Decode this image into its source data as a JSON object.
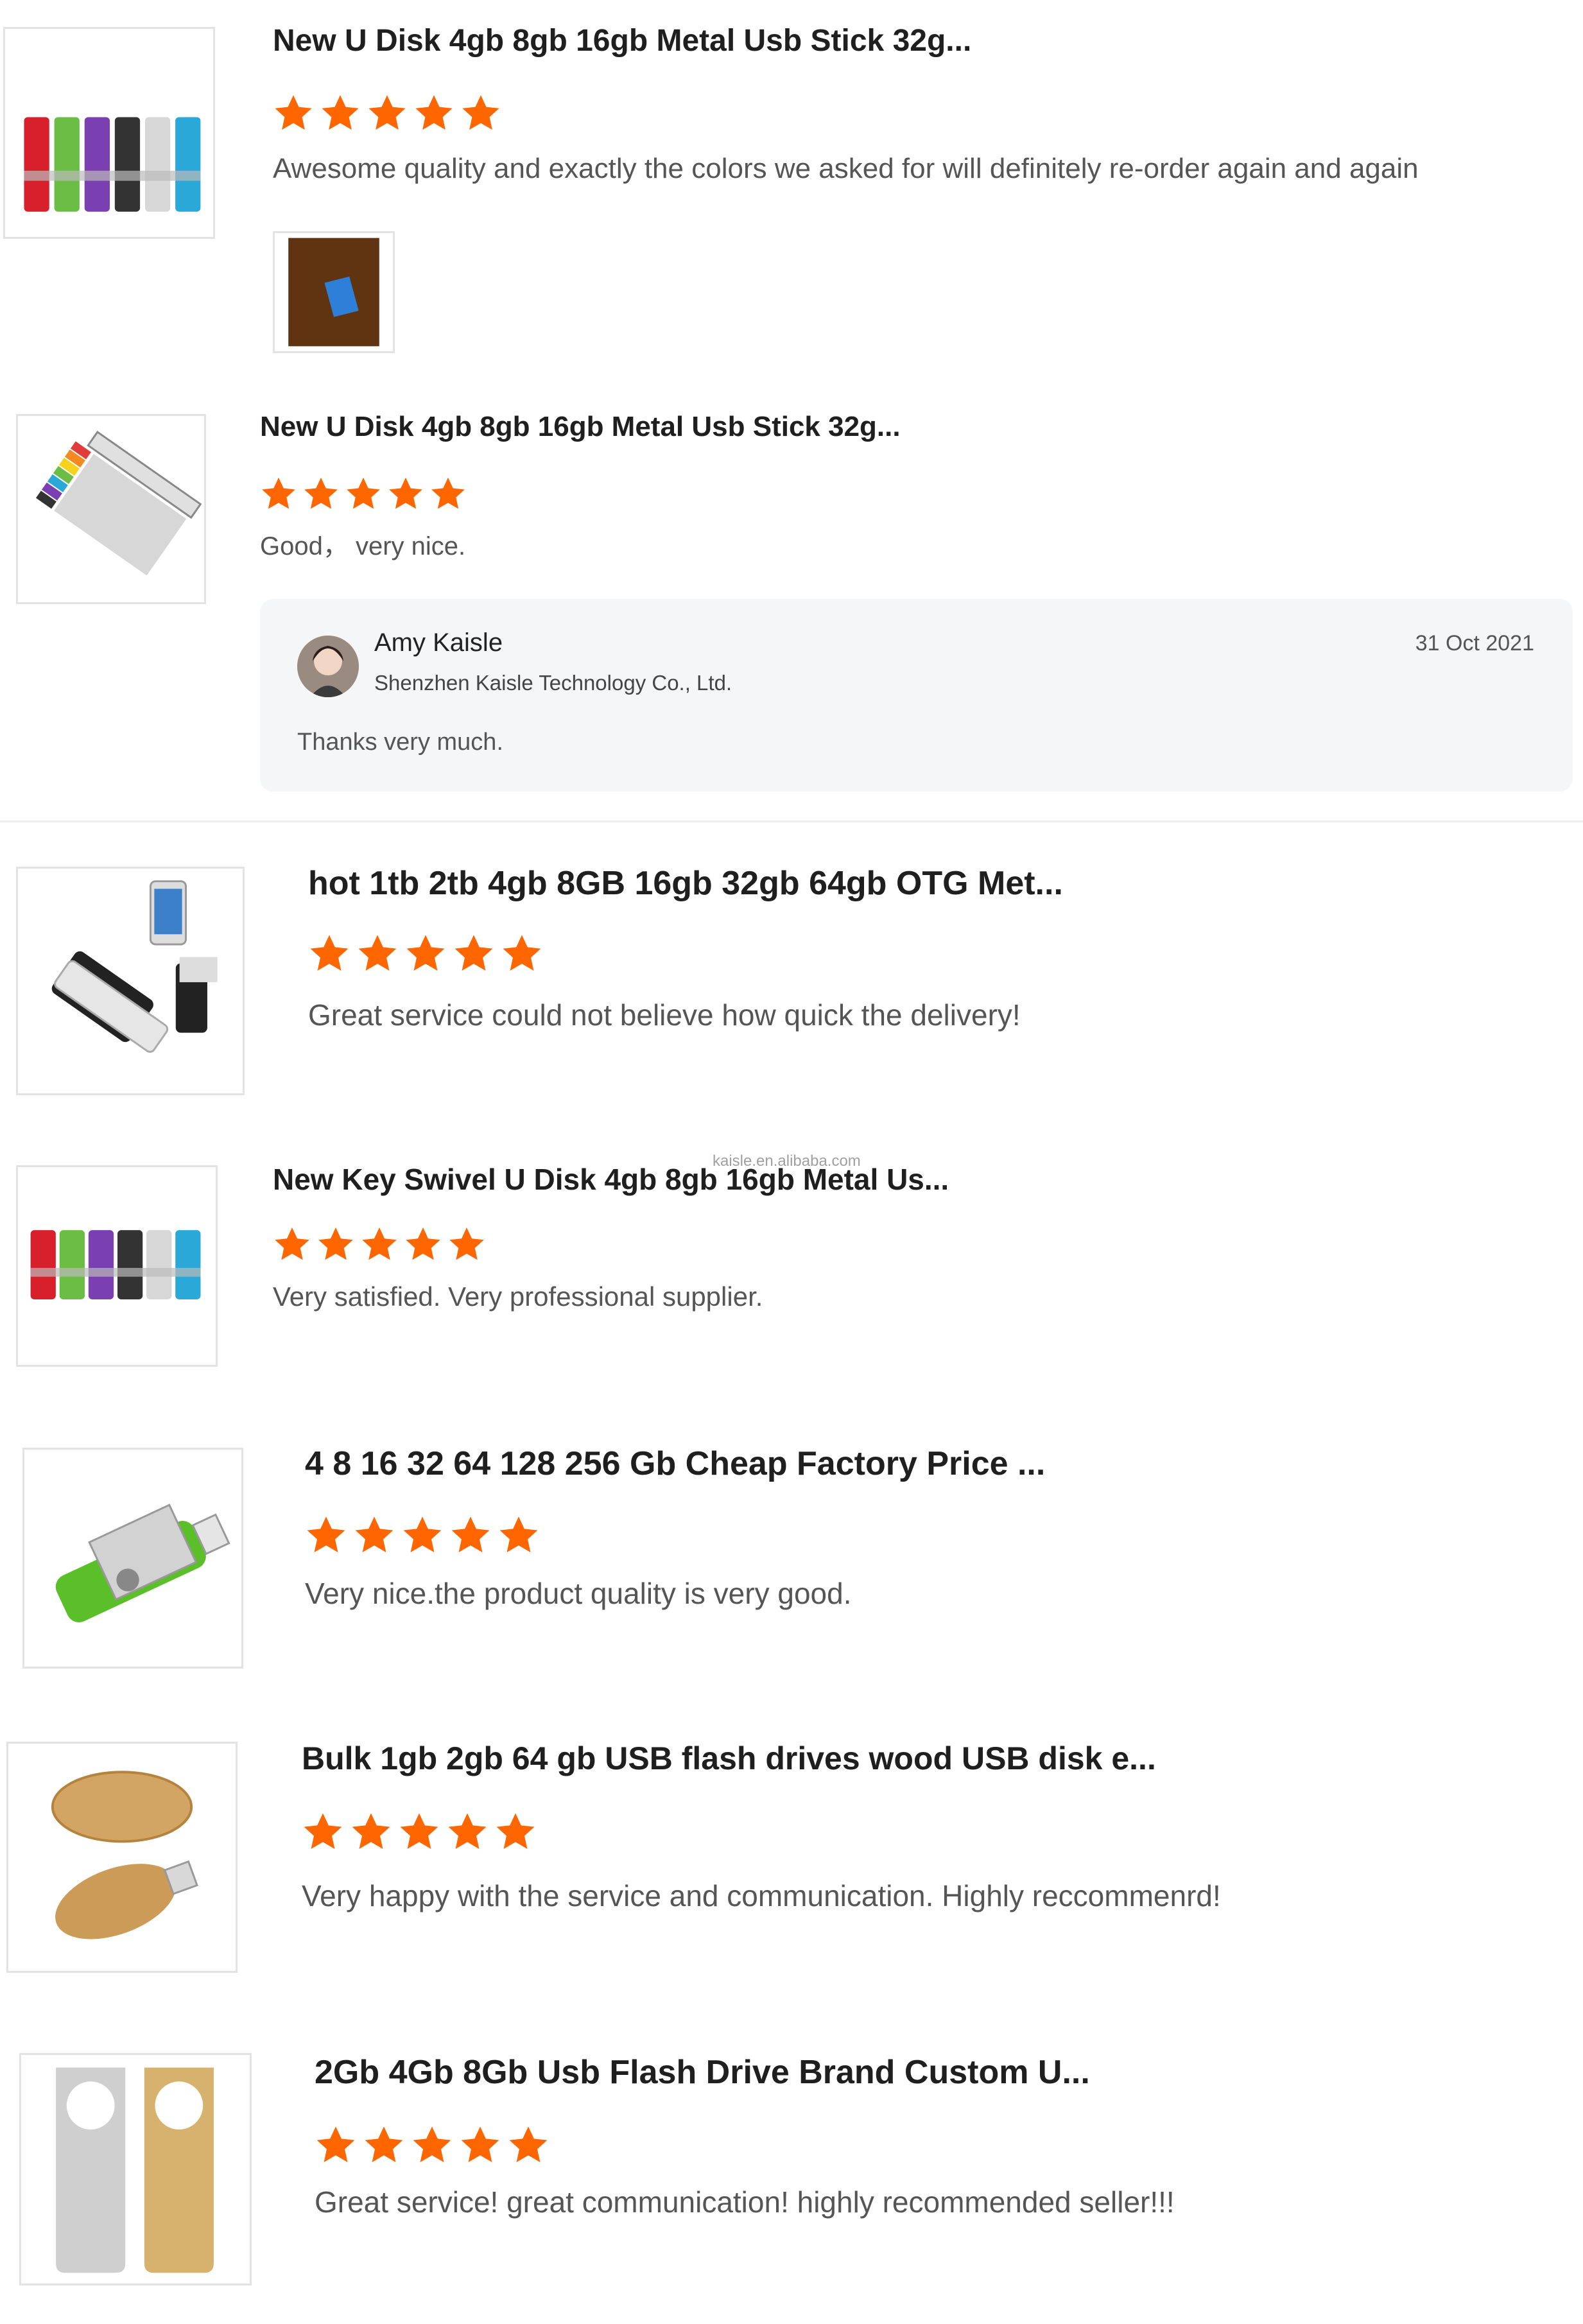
{
  "accent_color": "#ff6600",
  "reviews": [
    {
      "title": "New U Disk 4gb 8gb 16gb Metal Usb Stick 32g...",
      "rating": 5,
      "text": "Awesome quality and exactly the colors we asked for  will definitely re-order again and again",
      "thumbnail": "colorful-swivel-usb-sticks",
      "attached_photo": "customer-photo"
    },
    {
      "title": "New U Disk 4gb 8gb 16gb Metal Usb Stick 32g...",
      "rating": 5,
      "text": "Good，  very nice.",
      "thumbnail": "fanned-usb-sticks",
      "reply": {
        "name": "Amy Kaisle",
        "company": "Shenzhen Kaisle Technology Co., Ltd.",
        "date": "31 Oct 2021",
        "text": "Thanks very much."
      }
    },
    {
      "title": "hot 1tb 2tb 4gb 8GB 16gb 32gb 64gb OTG Met...",
      "rating": 5,
      "text": "Great service could not believe how quick the delivery!",
      "thumbnail": "otg-usb-with-phone"
    },
    {
      "title": "New Key Swivel U Disk 4gb 8gb 16gb Metal Us...",
      "rating": 5,
      "text": "Very satisfied. Very professional supplier.",
      "thumbnail": "colorful-swivel-usb-sticks"
    },
    {
      "title": "4 8 16 32 64 128 256 Gb Cheap Factory Price ...",
      "rating": 5,
      "text": "Very nice.the product quality is very good.",
      "thumbnail": "green-otg-usb"
    },
    {
      "title": "Bulk 1gb 2gb 64 gb USB flash drives wood USB disk e...",
      "rating": 5,
      "text": "Very happy with the service and communication.  Highly reccommenrd!",
      "thumbnail": "wooden-usb-drives"
    },
    {
      "title": "2Gb 4Gb 8Gb Usb Flash Drive Brand Custom U...",
      "rating": 5,
      "text": "Great service! great communication! highly recommended seller!!!",
      "thumbnail": "metal-keyring-usb-drives"
    }
  ],
  "watermark": "kaisle.en.alibaba.com"
}
